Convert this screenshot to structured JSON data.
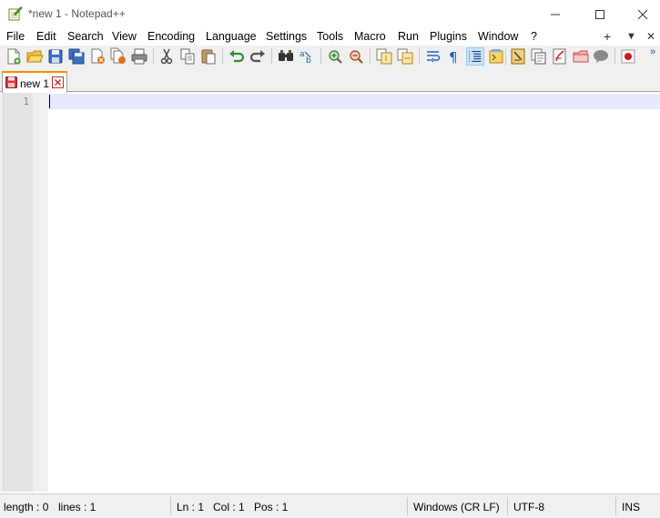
{
  "window": {
    "title": "*new 1 - Notepad++",
    "icon": "notepad-plus-plus-app-icon"
  },
  "menu": {
    "items": [
      "File",
      "Edit",
      "Search",
      "View",
      "Encoding",
      "Language",
      "Settings",
      "Tools",
      "Macro",
      "Run",
      "Plugins",
      "Window",
      "?"
    ],
    "right_add": "+",
    "right_dropdown": "▼",
    "right_close": "✕"
  },
  "toolbar": {
    "buttons": [
      "new-file",
      "open-file",
      "save",
      "save-all",
      "close",
      "close-all",
      "print",
      "cut",
      "copy",
      "paste",
      "undo",
      "redo",
      "find",
      "replace",
      "zoom-in",
      "zoom-out",
      "sync-vertical",
      "sync-horizontal",
      "word-wrap",
      "show-all-characters",
      "indent-guide",
      "user-defined-language",
      "document-map",
      "function-list",
      "folder-as-workspace",
      "monitoring",
      "start-recording"
    ],
    "active_button": "indent-guide",
    "more": "»"
  },
  "tabs": [
    {
      "label": "new 1",
      "modified": true
    }
  ],
  "editor": {
    "line_numbers": [
      "1"
    ],
    "content": ""
  },
  "status": {
    "length": "length : 0",
    "lines": "lines : 1",
    "ln": "Ln : 1",
    "col": "Col : 1",
    "pos": "Pos : 1",
    "eol": "Windows (CR LF)",
    "encoding": "UTF-8",
    "mode": "INS"
  },
  "colors": {
    "current_line": "#e8e8ff",
    "tab_accent": "#ff8a00",
    "gutter": "#e4e4e4"
  }
}
